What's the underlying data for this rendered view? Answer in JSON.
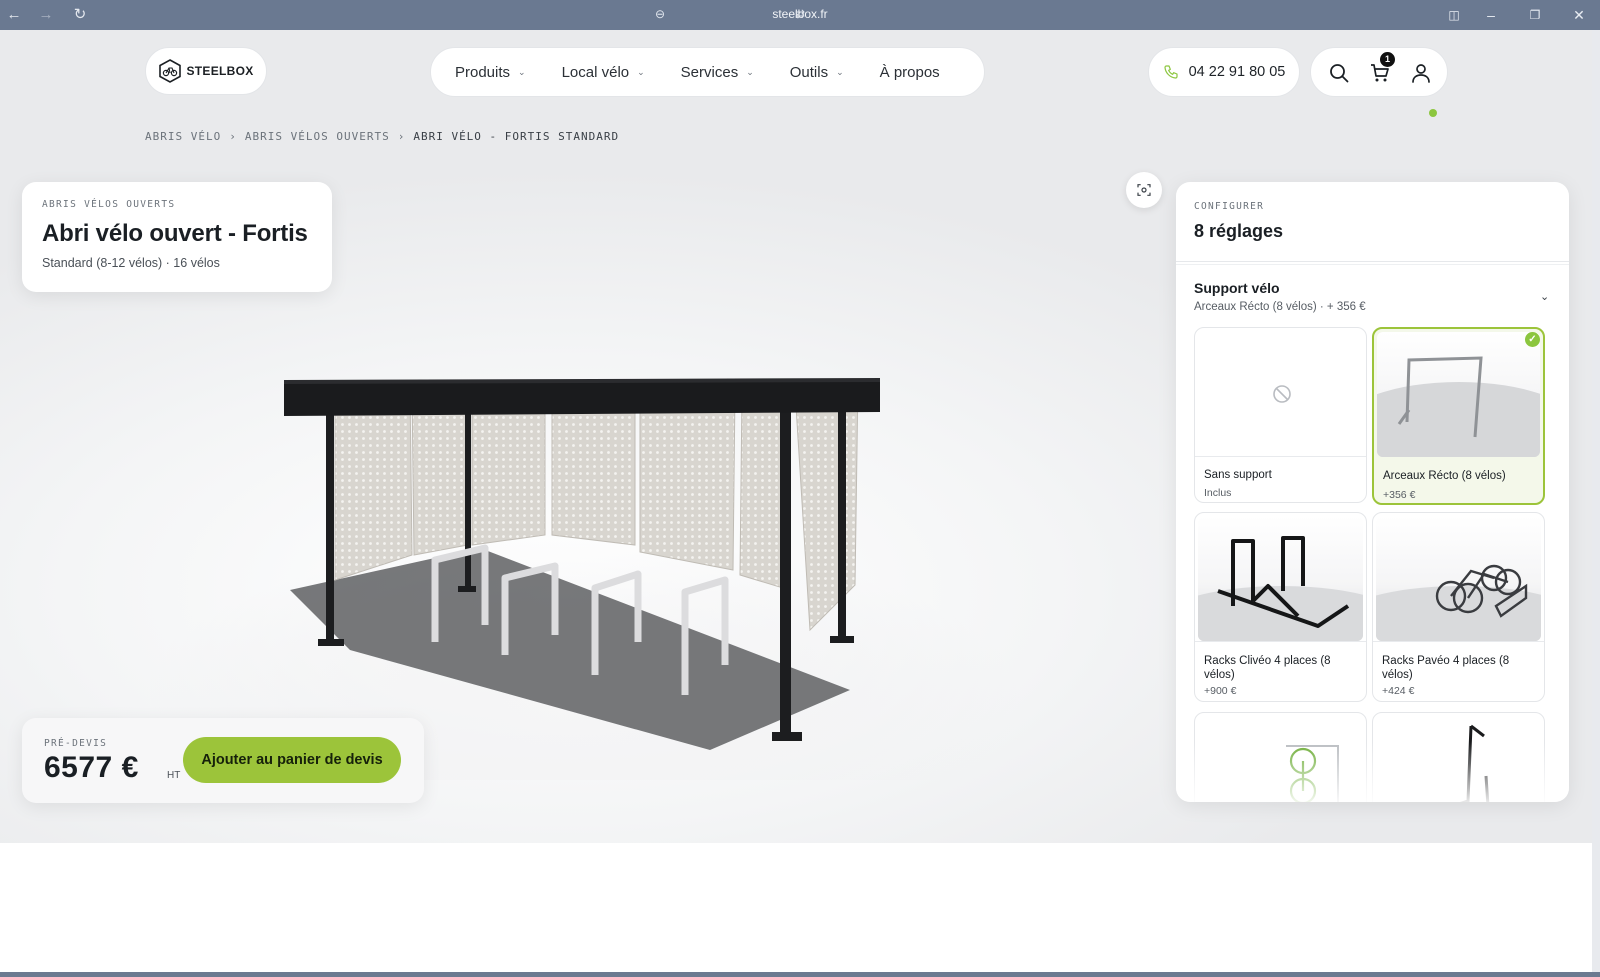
{
  "browser": {
    "url": "steelbox.fr"
  },
  "header": {
    "logo_text": "STEELBOX",
    "nav": [
      {
        "label": "Produits",
        "has_dropdown": true
      },
      {
        "label": "Local vélo",
        "has_dropdown": true
      },
      {
        "label": "Services",
        "has_dropdown": true
      },
      {
        "label": "Outils",
        "has_dropdown": true
      },
      {
        "label": "À propos",
        "has_dropdown": false
      }
    ],
    "phone": "04 22 91 80 05",
    "cart_count": "1",
    "icons": [
      "search-icon",
      "cart-icon",
      "user-icon"
    ]
  },
  "breadcrumb": [
    "ABRIS VÉLO",
    "ABRIS VÉLOS OUVERTS",
    "ABRI VÉLO - FORTIS STANDARD"
  ],
  "breadcrumb_sep": "›",
  "product": {
    "category": "ABRIS VÉLOS OUVERTS",
    "title": "Abri vélo ouvert - Fortis",
    "subtitle": "Standard (8-12 vélos) · 16 vélos"
  },
  "price": {
    "label": "PRÉ-DEVIS",
    "value": "6577 €",
    "unit": "HT",
    "cta": "Ajouter au panier de devis"
  },
  "configurator": {
    "eyebrow": "CONFIGURER",
    "title": "8 réglages",
    "section": {
      "title": "Support vélo",
      "subtitle": "Arceaux Récto (8 vélos) · + 356 €"
    },
    "options": [
      {
        "label": "Sans support",
        "price": "Inclus",
        "selected": false
      },
      {
        "label": "Arceaux Récto (8 vélos)",
        "price": "+356 €",
        "selected": true
      },
      {
        "label": "Racks Clivéo 4 places (8 vélos)",
        "price": "+900 €",
        "selected": false
      },
      {
        "label": "Racks Pavéo 4 places (8 vélos)",
        "price": "+424 €",
        "selected": false
      },
      {
        "label": "",
        "price": "",
        "selected": false
      },
      {
        "label": "",
        "price": "",
        "selected": false
      }
    ]
  },
  "colors": {
    "accent": "#9cc43a",
    "accent_dot": "#8cc63f",
    "text": "#1a1f24",
    "chrome": "#6a7991"
  }
}
